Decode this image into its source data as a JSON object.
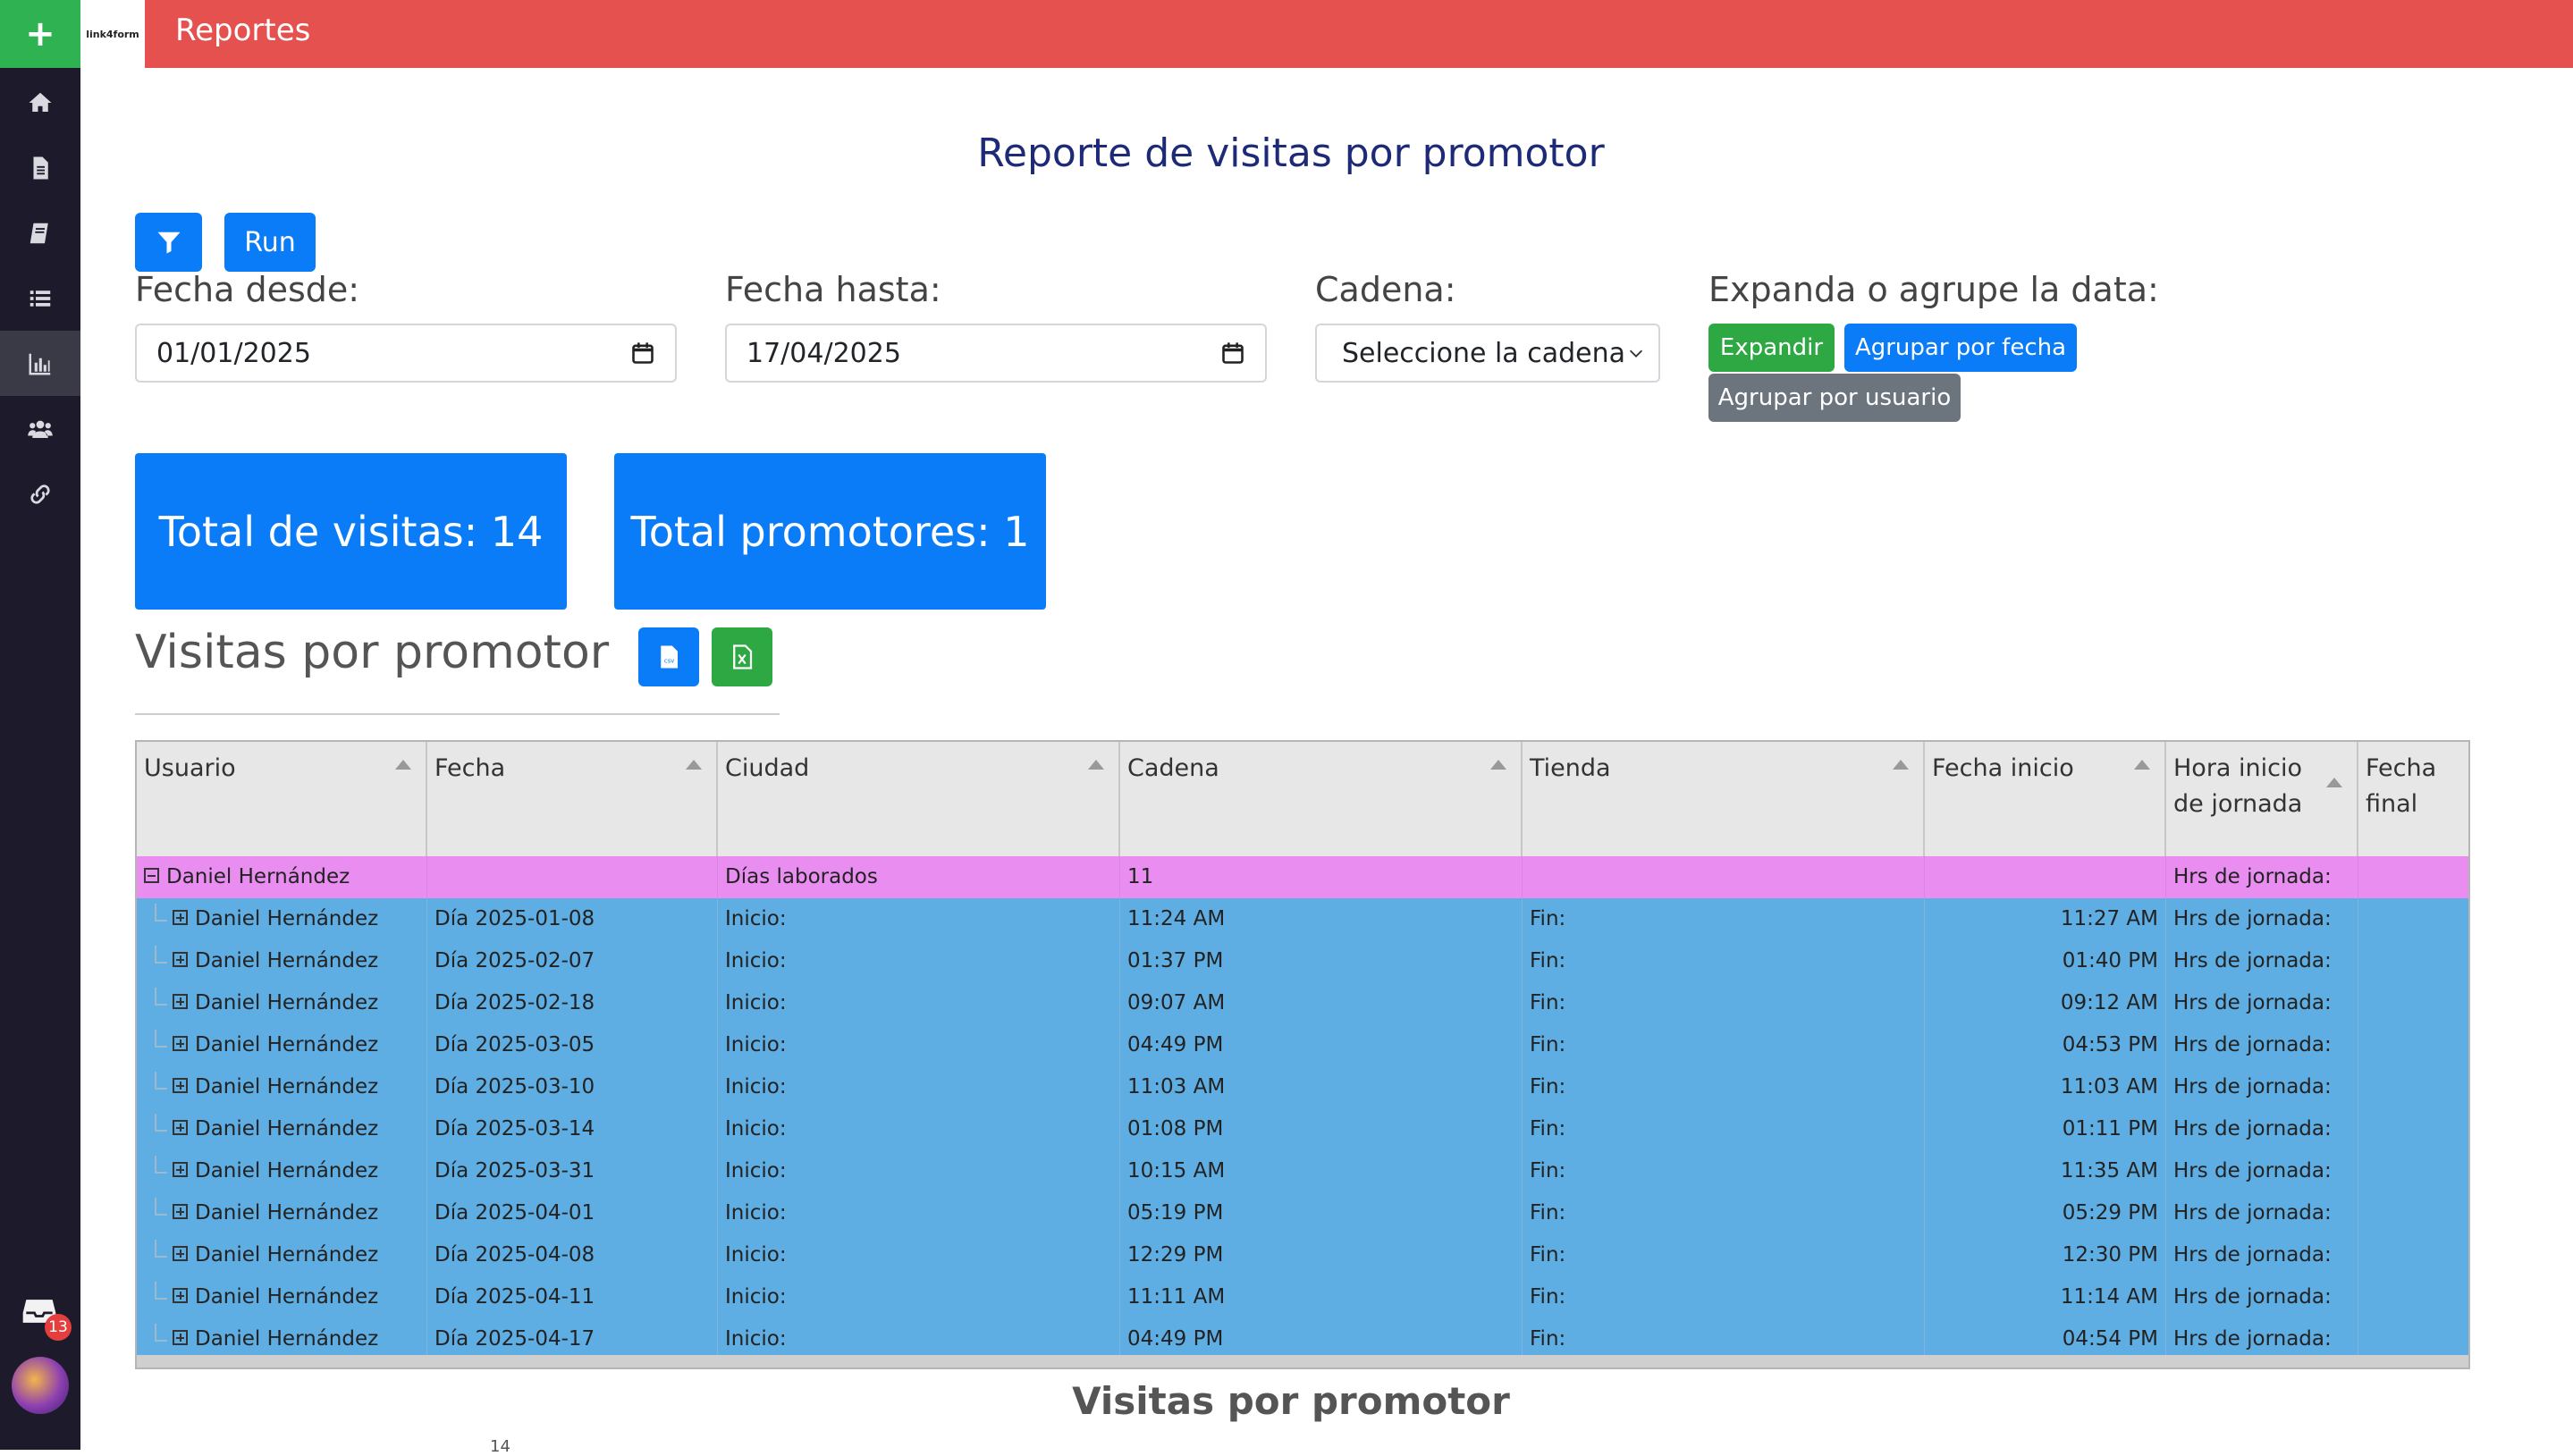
{
  "sidebar": {
    "add_label": "+",
    "inbox_count": "13"
  },
  "header": {
    "logo_text": "link4form",
    "app_title": "Reportes"
  },
  "page_title": "Reporte de visitas por promotor",
  "toolbar": {
    "run_label": "Run"
  },
  "filters": {
    "fecha_desde": {
      "label": "Fecha desde:",
      "value": "01/01/2025"
    },
    "fecha_hasta": {
      "label": "Fecha hasta:",
      "value": "17/04/2025"
    },
    "cadena": {
      "label": "Cadena:",
      "value": "Seleccione la cadena"
    },
    "expand": {
      "label": "Expanda o agrupe la data:",
      "expandir": "Expandir",
      "agrupar_fecha": "Agrupar por fecha",
      "agrupar_usuario": "Agrupar por usuario"
    }
  },
  "stats": {
    "visitas": "Total de visitas: 14",
    "promotores": "Total promotores: 1"
  },
  "section": {
    "title": "Visitas por promotor",
    "csv_label": "csv"
  },
  "table": {
    "columns": [
      "Usuario",
      "Fecha",
      "Ciudad",
      "Cadena",
      "Tienda",
      "Fecha inicio",
      "Hora inicio de jornada",
      "Fecha final"
    ],
    "group_row": {
      "usuario": "Daniel Hernández",
      "ciudad": "Días laborados",
      "cadena": "11",
      "hora": "Hrs de jornada:"
    },
    "rows": [
      {
        "usuario": "Daniel Hernández",
        "fecha": "Día 2025-01-08",
        "ciudad": "Inicio:",
        "cadena": "11:24 AM",
        "tienda": "Fin:",
        "fin": "11:27 AM",
        "hrs": "Hrs de jornada:"
      },
      {
        "usuario": "Daniel Hernández",
        "fecha": "Día 2025-02-07",
        "ciudad": "Inicio:",
        "cadena": "01:37 PM",
        "tienda": "Fin:",
        "fin": "01:40 PM",
        "hrs": "Hrs de jornada:"
      },
      {
        "usuario": "Daniel Hernández",
        "fecha": "Día 2025-02-18",
        "ciudad": "Inicio:",
        "cadena": "09:07 AM",
        "tienda": "Fin:",
        "fin": "09:12 AM",
        "hrs": "Hrs de jornada:"
      },
      {
        "usuario": "Daniel Hernández",
        "fecha": "Día 2025-03-05",
        "ciudad": "Inicio:",
        "cadena": "04:49 PM",
        "tienda": "Fin:",
        "fin": "04:53 PM",
        "hrs": "Hrs de jornada:"
      },
      {
        "usuario": "Daniel Hernández",
        "fecha": "Día 2025-03-10",
        "ciudad": "Inicio:",
        "cadena": "11:03 AM",
        "tienda": "Fin:",
        "fin": "11:03 AM",
        "hrs": "Hrs de jornada:"
      },
      {
        "usuario": "Daniel Hernández",
        "fecha": "Día 2025-03-14",
        "ciudad": "Inicio:",
        "cadena": "01:08 PM",
        "tienda": "Fin:",
        "fin": "01:11 PM",
        "hrs": "Hrs de jornada:"
      },
      {
        "usuario": "Daniel Hernández",
        "fecha": "Día 2025-03-31",
        "ciudad": "Inicio:",
        "cadena": "10:15 AM",
        "tienda": "Fin:",
        "fin": "11:35 AM",
        "hrs": "Hrs de jornada:"
      },
      {
        "usuario": "Daniel Hernández",
        "fecha": "Día 2025-04-01",
        "ciudad": "Inicio:",
        "cadena": "05:19 PM",
        "tienda": "Fin:",
        "fin": "05:29 PM",
        "hrs": "Hrs de jornada:"
      },
      {
        "usuario": "Daniel Hernández",
        "fecha": "Día 2025-04-08",
        "ciudad": "Inicio:",
        "cadena": "12:29 PM",
        "tienda": "Fin:",
        "fin": "12:30 PM",
        "hrs": "Hrs de jornada:"
      },
      {
        "usuario": "Daniel Hernández",
        "fecha": "Día 2025-04-11",
        "ciudad": "Inicio:",
        "cadena": "11:11 AM",
        "tienda": "Fin:",
        "fin": "11:14 AM",
        "hrs": "Hrs de jornada:"
      },
      {
        "usuario": "Daniel Hernández",
        "fecha": "Día 2025-04-17",
        "ciudad": "Inicio:",
        "cadena": "04:49 PM",
        "tienda": "Fin:",
        "fin": "04:54 PM",
        "hrs": "Hrs de jornada:"
      }
    ]
  },
  "chart": {
    "title": "Visitas por promotor",
    "first_tick": "14"
  }
}
